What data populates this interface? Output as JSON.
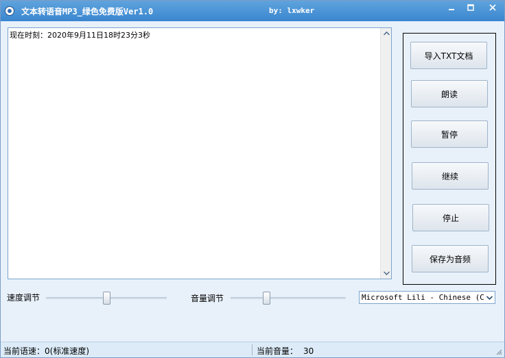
{
  "window": {
    "title": "文本转语音MP3_绿色免费版Ver1.0",
    "author": "by: lxwker"
  },
  "textarea": {
    "content": "现在时刻：2020年9月11日18时23分3秒"
  },
  "buttons": {
    "import_txt": "导入TXT文档",
    "read": "朗读",
    "pause": "暂停",
    "resume": "继续",
    "stop": "停止",
    "save_audio": "保存为音频"
  },
  "controls": {
    "speed_label": "速度调节",
    "volume_label": "音量调节",
    "speed_level": 0,
    "volume_level": 30,
    "voice_selected": "Microsoft Lili - Chinese (China)"
  },
  "statusbar": {
    "speed_label": "当前语速：",
    "speed_value": "0(标准速度)",
    "volume_label": "当前音量：",
    "volume_value": "30"
  },
  "icons": {
    "app": "speaker-icon",
    "minimize": "minimize-icon",
    "maximize": "maximize-icon",
    "close": "close-icon"
  }
}
